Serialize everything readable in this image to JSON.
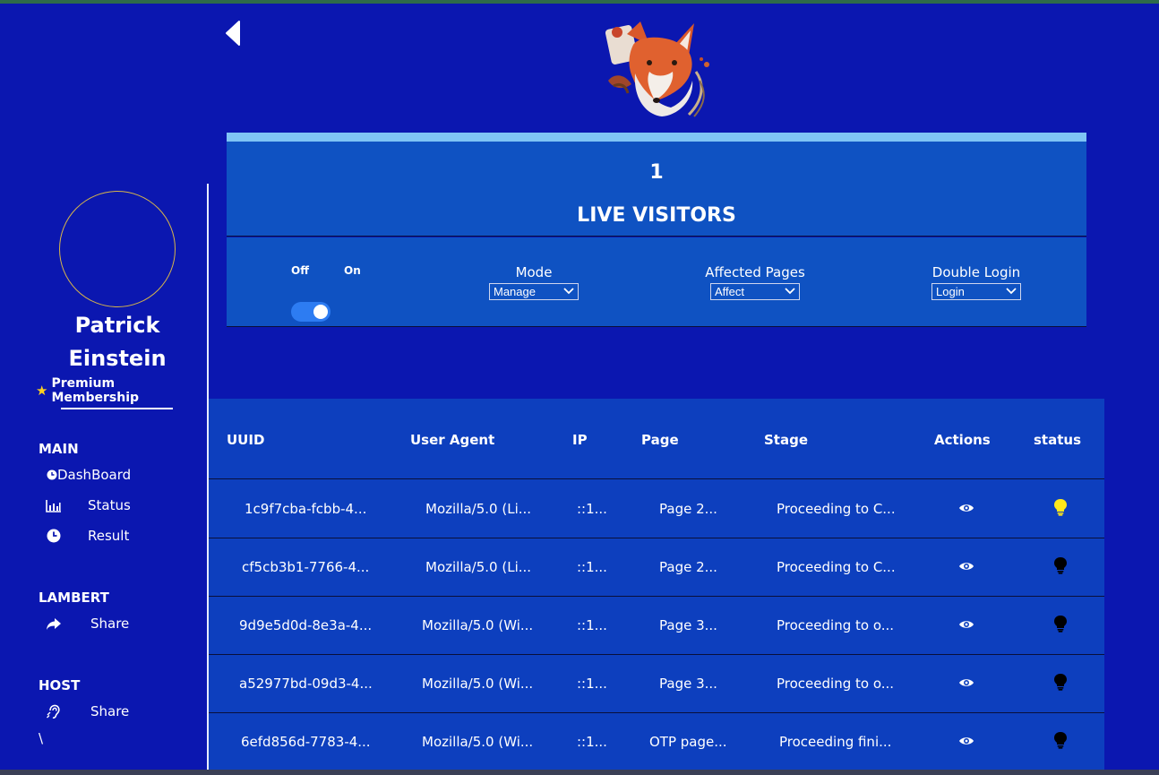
{
  "profile": {
    "first_name": "Patrick",
    "last_name": "Einstein",
    "membership": "Premium Membership"
  },
  "sidebar": {
    "sections": [
      {
        "title": "MAIN",
        "items": [
          {
            "label": "DashBoard",
            "icon": "clock-icon"
          },
          {
            "label": "Status",
            "icon": "bar-chart-icon"
          },
          {
            "label": "Result",
            "icon": "clock-icon"
          }
        ]
      },
      {
        "title": "LAMBERT",
        "items": [
          {
            "label": "Share",
            "icon": "share-arrow-icon"
          }
        ]
      },
      {
        "title": "HOST",
        "items": [
          {
            "label": "Share",
            "icon": "ear-icon"
          }
        ]
      }
    ],
    "stray_text": "\\"
  },
  "stats": {
    "live_count": "1",
    "live_label": "LIVE VISITORS"
  },
  "controls": {
    "toggle_off_label": "Off",
    "toggle_on_label": "On",
    "toggle_state": "on",
    "mode": {
      "label": "Mode",
      "value": "Manage"
    },
    "affected_pages": {
      "label": "Affected Pages",
      "value": "Affect"
    },
    "double_login": {
      "label": "Double Login",
      "value": "Login"
    }
  },
  "table": {
    "columns": [
      "UUID",
      "User Agent",
      "IP",
      "Page",
      "Stage",
      "Actions",
      "status"
    ],
    "rows": [
      {
        "uuid": "1c9f7cba-fcbb-4...",
        "agent": "Mozilla/5.0 (Li...",
        "ip": "::1...",
        "page": "Page 2...",
        "stage": "Proceeding to C...",
        "status": "active"
      },
      {
        "uuid": "cf5cb3b1-7766-4...",
        "agent": "Mozilla/5.0 (Li...",
        "ip": "::1...",
        "page": "Page 2...",
        "stage": "Proceeding to C...",
        "status": "inactive"
      },
      {
        "uuid": "9d9e5d0d-8e3a-4...",
        "agent": "Mozilla/5.0 (Wi...",
        "ip": "::1...",
        "page": "Page 3...",
        "stage": "Proceeding to o...",
        "status": "inactive"
      },
      {
        "uuid": "a52977bd-09d3-4...",
        "agent": "Mozilla/5.0 (Wi...",
        "ip": "::1...",
        "page": "Page 3...",
        "stage": "Proceeding to o...",
        "status": "inactive"
      },
      {
        "uuid": "6efd856d-7783-4...",
        "agent": "Mozilla/5.0 (Wi...",
        "ip": "::1...",
        "page": "OTP page...",
        "stage": "Proceeding fini...",
        "status": "inactive"
      }
    ]
  },
  "colors": {
    "background": "#0b17b0",
    "panel": "#0f52c2",
    "accent_bar": "#7fc4f5",
    "status_active": "#ffe81a",
    "status_inactive": "#000000",
    "avatar_ring": "#d7b54a",
    "star": "#ffd21f"
  }
}
